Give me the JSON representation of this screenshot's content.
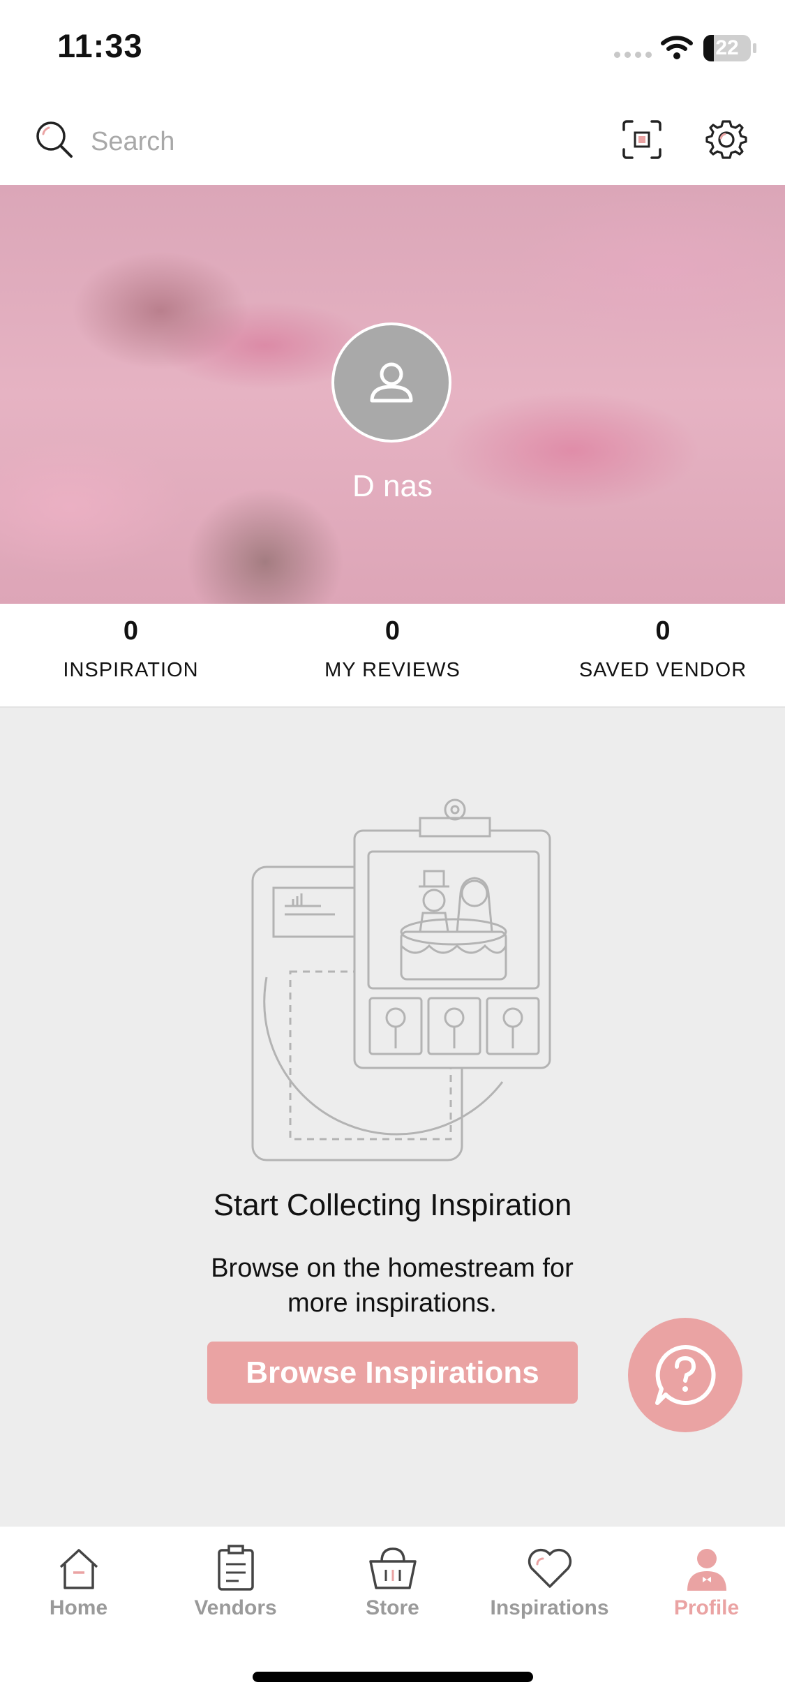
{
  "status_bar": {
    "time": "11:33",
    "battery": "22",
    "battery_level": 0.22
  },
  "search": {
    "placeholder": "Search"
  },
  "profile": {
    "name": "D nas"
  },
  "stats": [
    {
      "value": "0",
      "label": "INSPIRATION"
    },
    {
      "value": "0",
      "label": "MY REVIEWS"
    },
    {
      "value": "0",
      "label": "SAVED VENDOR"
    }
  ],
  "empty_state": {
    "title": "Start Collecting Inspiration",
    "description": "Browse on the homestream for more inspirations.",
    "button_label": "Browse Inspirations"
  },
  "tabs": [
    {
      "label": "Home",
      "icon": "home-icon"
    },
    {
      "label": "Vendors",
      "icon": "clipboard-icon"
    },
    {
      "label": "Store",
      "icon": "basket-icon"
    },
    {
      "label": "Inspirations",
      "icon": "heart-icon"
    },
    {
      "label": "Profile",
      "icon": "profile-icon",
      "active": true
    }
  ],
  "colors": {
    "accent": "#eaa3a3",
    "inactive_tab": "#9a9a9a"
  }
}
